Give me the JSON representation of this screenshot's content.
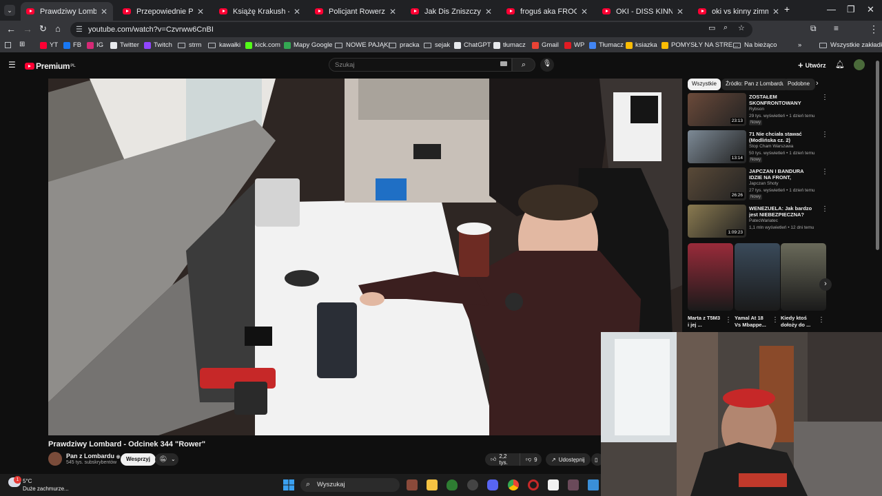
{
  "browser": {
    "tabs": [
      {
        "title": "Prawdziwy Lombard - Odc",
        "active": true
      },
      {
        "title": "Przepowiednie Prześwira"
      },
      {
        "title": "Książę Krakush - YouTube"
      },
      {
        "title": "Policjant Rowerzysta, któr"
      },
      {
        "title": "Jak Dis Zniszczył Swoją K"
      },
      {
        "title": "froguś aka FROG wbija si"
      },
      {
        "title": "OKI - DISS KINNY ZIMME"
      },
      {
        "title": "oki vs kinny zimmer - You"
      }
    ],
    "new_tab_label": "+",
    "url": "youtube.com/watch?v=Czvrww6CnBI",
    "bookmarks": [
      {
        "label": "YT",
        "color": "#ff0033"
      },
      {
        "label": "FB",
        "color": "#1877f2"
      },
      {
        "label": "IG",
        "color": "#d62976"
      },
      {
        "label": "Twitter",
        "color": "#e8eaed"
      },
      {
        "label": "Twitch",
        "color": "#9146ff"
      },
      {
        "label": "strm",
        "folder": true
      },
      {
        "label": "kawałki",
        "folder": true
      },
      {
        "label": "kick.com",
        "color": "#53fc18"
      },
      {
        "label": "Mapy Google",
        "color": "#34a853"
      },
      {
        "label": "NOWE PAJĄKI",
        "folder": true
      },
      {
        "label": "pracka",
        "folder": true
      },
      {
        "label": "sejak",
        "folder": true
      },
      {
        "label": "ChatGPT",
        "color": "#e8eaed"
      },
      {
        "label": "tłumacz",
        "color": "#e8eaed"
      },
      {
        "label": "Gmail",
        "color": "#ea4335"
      },
      {
        "label": "WP",
        "color": "#e21b23"
      },
      {
        "label": "Tłumacz",
        "color": "#4285f4"
      },
      {
        "label": "ksiazka",
        "color": "#fbbc04"
      },
      {
        "label": "POMYSŁY NA STRE...",
        "color": "#fbbc04"
      },
      {
        "label": "Na bieżąco",
        "folder": true
      }
    ],
    "all_bookmarks_label": "Wszystkie zakładki",
    "more_bookmarks_label": "»"
  },
  "youtube": {
    "logo_text": "Premium",
    "logo_region": "PL",
    "search_placeholder": "Szukaj",
    "create_label": "Utwórz",
    "video": {
      "title": "Prawdziwy Lombard - Odcinek 344 \"Rower\"",
      "channel": "Pan z Lombardu",
      "subscribers": "545 tys. subskrybentów",
      "support_label": "Wesprzyj",
      "likes": "2,2 tys.",
      "dislikes": "9",
      "share_label": "Udostępnij"
    },
    "chips": [
      "Wszystkie",
      "Źródło: Pan z Lombardu",
      "Podobne"
    ],
    "recommendations": [
      {
        "title": "ZOSTAŁEM SKONFRONTOWANY PRZEZ ...",
        "channel": "Rybson",
        "meta": "29 tys. wyświetleń • 1 dzień temu",
        "badge": "Nowy",
        "duration": "23:13",
        "color": "#6b4a3a"
      },
      {
        "title": "71 Nie chciała stawać (Modlińska cz. 2)",
        "channel": "Stop Cham Warszawa",
        "meta": "50 tys. wyświetleń • 1 dzień temu",
        "badge": "Nowy",
        "duration": "13:14",
        "color": "#7d8a96"
      },
      {
        "title": "JAPCZAN I BANDURA IDZIE NA FRONT, JASNOWIDZ, DOM ...",
        "channel": "Japczan Shoty",
        "meta": "27 tys. wyświetleń • 1 dzień temu",
        "badge": "Nowy",
        "duration": "26:26",
        "color": "#5a4a38"
      },
      {
        "title": "WENEZUELA: Jak bardzo jest NIEBEZPIECZNA?",
        "channel": "PatecWariatec",
        "meta": "1,1 mln wyświetleń • 12 dni temu",
        "badge": "",
        "duration": "1:09:23",
        "color": "#8a7a50"
      }
    ],
    "shorts": [
      {
        "title": "Marta z T5M3 i jej ...",
        "color": "#9a2b3a"
      },
      {
        "title": "Yamal At 18 Vs Mbappe...",
        "color": "#3a4a5a"
      },
      {
        "title": "Kiedy ktoś dołoży do ...",
        "color": "#6a6a5a"
      }
    ]
  },
  "taskbar": {
    "weather_temp": "5°C",
    "weather_desc": "Duże zachmurze...",
    "notification_count": "1",
    "search_label": "Wyszukaj"
  }
}
